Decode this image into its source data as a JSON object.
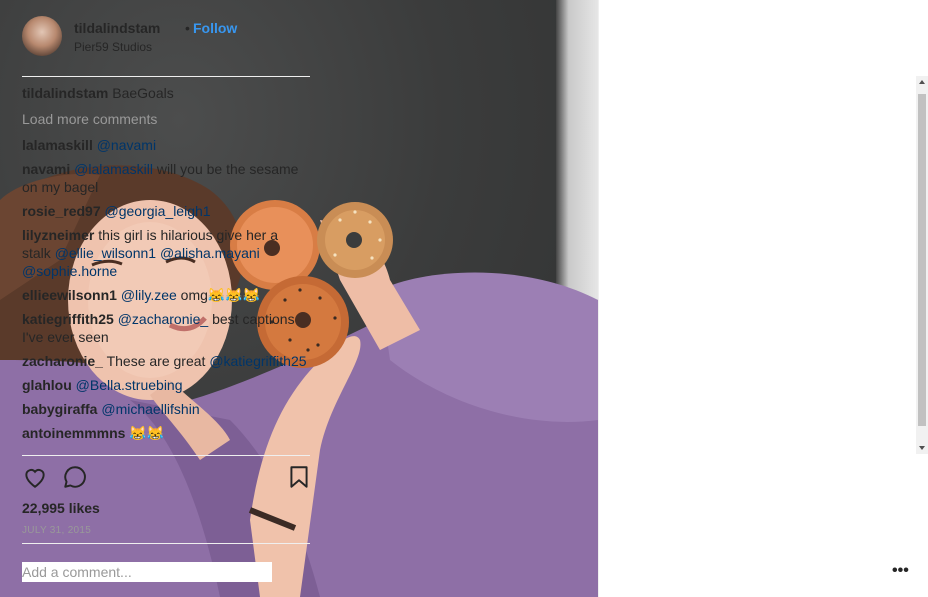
{
  "post": {
    "username": "tildalindstam",
    "separator": "•",
    "follow_label": "Follow",
    "location": "Pier59 Studios",
    "caption": {
      "user": "tildalindstam",
      "text": "BaeGoals"
    },
    "load_more": "Load more comments",
    "comments": [
      {
        "user": "lalamaskill",
        "parts": [
          {
            "mention": "@navami"
          }
        ]
      },
      {
        "user": "navami",
        "parts": [
          {
            "mention": "@lalamaskill"
          },
          {
            "text": " will you be the sesame on my bagel"
          }
        ]
      },
      {
        "user": "rosie_red97",
        "parts": [
          {
            "mention": "@georgia_leigh1"
          }
        ]
      },
      {
        "user": "lilyzneimer",
        "parts": [
          {
            "text": "this girl is hilarious give her a stalk "
          },
          {
            "mention": "@ellie_wilsonn1"
          },
          {
            "text": " "
          },
          {
            "mention": "@alisha.mayani"
          },
          {
            "text": " "
          },
          {
            "mention": "@sophie.horne"
          }
        ]
      },
      {
        "user": "ellieewilsonn1",
        "parts": [
          {
            "mention": "@lily.zee"
          },
          {
            "text": " omg😹😹😹"
          }
        ]
      },
      {
        "user": "katiegriffith25",
        "parts": [
          {
            "mention": "@zacharonie_"
          },
          {
            "text": " best captions I've ever seen"
          }
        ]
      },
      {
        "user": "zacharonie_",
        "parts": [
          {
            "text": "These are great "
          },
          {
            "mention": "@katiegriffith25"
          }
        ]
      },
      {
        "user": "glahlou",
        "parts": [
          {
            "mention": "@Bella.struebing"
          }
        ]
      },
      {
        "user": "babygiraffa",
        "parts": [
          {
            "mention": "@michaellifshin"
          }
        ]
      },
      {
        "user": "antoinemmmns",
        "parts": [
          {
            "text": " 😹😹"
          }
        ]
      }
    ],
    "likes": "22,995 likes",
    "date": "JULY 31, 2015",
    "add_comment_placeholder": "Add a comment...",
    "more_label": "•••"
  },
  "icons": {
    "like": "heart-icon",
    "comment": "comment-bubble-icon",
    "save": "bookmark-icon",
    "options": "more-options-icon"
  },
  "colors": {
    "follow": "#3897f0",
    "mention": "#003569",
    "muted": "#999999",
    "text": "#262626"
  }
}
